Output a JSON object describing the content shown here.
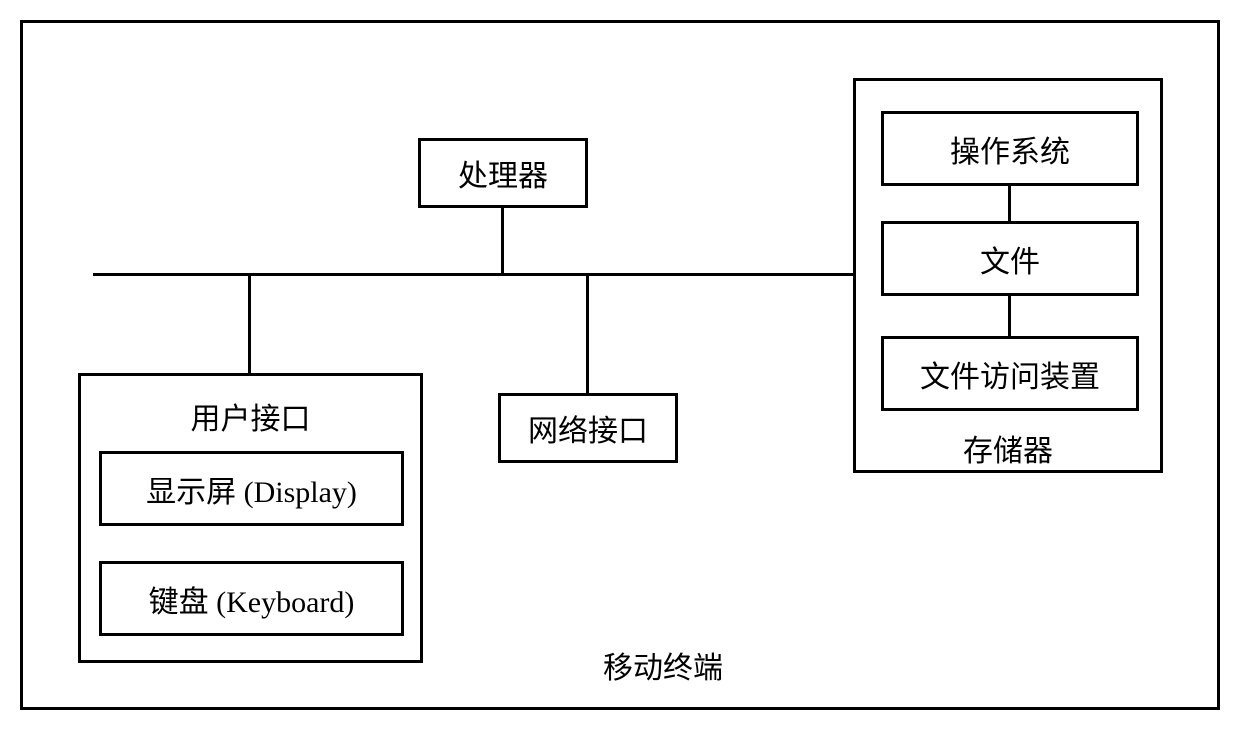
{
  "diagram": {
    "title": "移动终端",
    "processor": "处理器",
    "network_interface": "网络接口",
    "user_interface": {
      "title": "用户接口",
      "display": "显示屏 (Display)",
      "keyboard": "键盘 (Keyboard)"
    },
    "storage": {
      "title": "存储器",
      "os": "操作系统",
      "file": "文件",
      "file_access_device": "文件访问装置"
    }
  }
}
